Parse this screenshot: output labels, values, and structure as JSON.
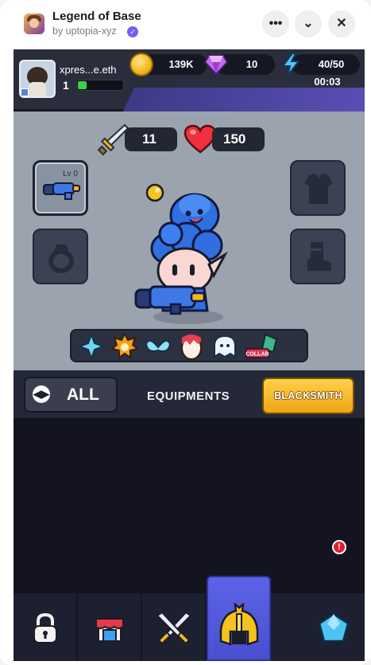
{
  "app": {
    "title": "Legend of Base",
    "publisher": "by uptopia-xyz",
    "more_label": "•••",
    "collapse_label": "⌄",
    "close_label": "✕"
  },
  "player": {
    "name": "xpres...e.eth",
    "level": "1",
    "xp_progress": 0.2
  },
  "resources": {
    "gold": "139K",
    "gems": "10",
    "energy": "40/50",
    "energy_timer": "00:03"
  },
  "stats": {
    "attack": "11",
    "health": "150"
  },
  "equipment": {
    "weapon_level": "Lv 0"
  },
  "pets_bar": {
    "collab_label": "COLLAB"
  },
  "filter": {
    "all_label": "ALL",
    "section_label": "EQUIPMENTS",
    "blacksmith_label": "BLACKSMITH"
  },
  "nav": {
    "alert_badge": "!"
  },
  "colors": {
    "accent": "#5c63e6",
    "blacksmith": "#ffc12b",
    "hero_hair": "#2f6fe0",
    "xp": "#3fd04a"
  }
}
